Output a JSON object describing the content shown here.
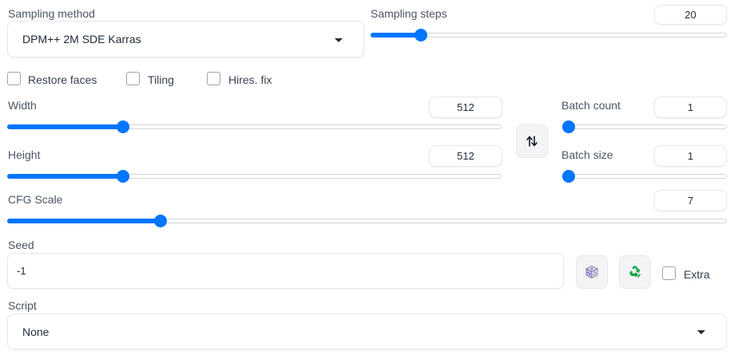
{
  "sampling": {
    "method_label": "Sampling method",
    "method_value": "DPM++ 2M SDE Karras",
    "steps_label": "Sampling steps",
    "steps_value": "20"
  },
  "checkboxes": {
    "restore_faces": "Restore faces",
    "tiling": "Tiling",
    "hires_fix": "Hires. fix"
  },
  "width": {
    "label": "Width",
    "value": "512",
    "level": 0.23
  },
  "height": {
    "label": "Height",
    "value": "512",
    "level": 0.23
  },
  "batch_count": {
    "label": "Batch count",
    "value": "1",
    "level": 0.0
  },
  "batch_size": {
    "label": "Batch size",
    "value": "1",
    "level": 0.0
  },
  "cfg": {
    "label": "CFG Scale",
    "value": "7",
    "level": 0.21
  },
  "steps_level": 0.14,
  "seed": {
    "label": "Seed",
    "value": "-1",
    "extra_label": "Extra"
  },
  "script": {
    "label": "Script",
    "value": "None"
  },
  "icons": {
    "swap": "swap-arrows-icon",
    "dice": "dice-icon",
    "recycle": "recycle-icon",
    "caret": "chevron-down-icon"
  },
  "colors": {
    "accent": "#0075ff",
    "recycle": "#16a34a"
  }
}
